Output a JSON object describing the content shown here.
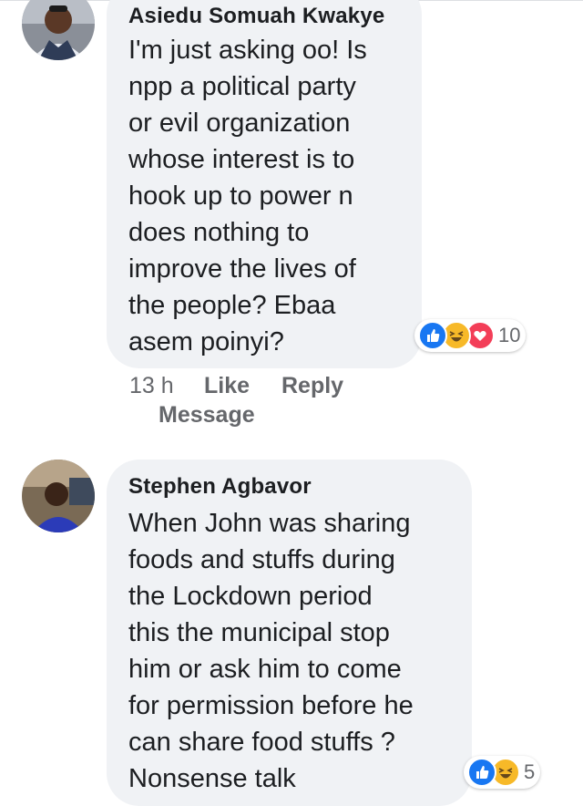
{
  "comments": [
    {
      "author": "Asiedu Somuah Kwakye",
      "text": "I'm just asking oo! Is\nnpp a political party\nor evil organization\nwhose interest is to\nhook up to power n\ndoes nothing to\nimprove the lives of\nthe people? Ebaa\nasem poinyi?",
      "time": "13 h",
      "like_label": "Like",
      "reply_label": "Reply",
      "message_label": "Message",
      "reactions": [
        "like-icon",
        "haha-icon",
        "love-icon"
      ],
      "reaction_count": "10"
    },
    {
      "author": "Stephen Agbavor",
      "text": "When John was sharing\nfoods and stuffs during\nthe Lockdown period\nthis the municipal stop\nhim or ask him to come\nfor permission before he\ncan share food stuffs ?\nNonsense talk",
      "reactions": [
        "like-icon",
        "haha-icon"
      ],
      "reaction_count": "5"
    }
  ],
  "colors": {
    "bubble": "#f0f2f5",
    "like_blue": "#1877f2",
    "haha_yellow": "#f7b928",
    "love_red": "#f33e58",
    "meta_gray": "#65676b"
  }
}
